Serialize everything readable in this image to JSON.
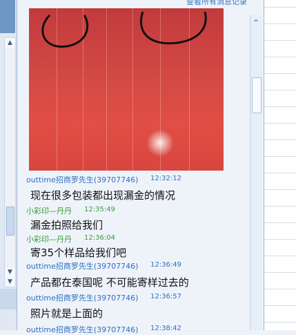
{
  "header": {
    "history_link": "查看所有消息记录"
  },
  "messages": [
    {
      "sender": "outtime招商罗先生(39707746)",
      "time": "12:32:12",
      "text": "现在很多包装都出现漏金的情况",
      "color": "#2f6fbd"
    },
    {
      "sender": "小彩印—丹丹",
      "time": "12:35:49",
      "text": "漏金拍照给我们",
      "color": "#3a9b3a"
    },
    {
      "sender": "小彩印—丹丹",
      "time": "12:36:04",
      "text": "寄35个样品给我们吧",
      "color": "#3a9b3a"
    },
    {
      "sender": "outtime招商罗先生(39707746)",
      "time": "12:36:49",
      "text": "产品都在泰国呢 不可能寄样过去的",
      "color": "#2f6fbd"
    },
    {
      "sender": "outtime招商罗先生(39707746)",
      "time": "12:36:57",
      "text": "照片就是上面的",
      "color": "#2f6fbd"
    },
    {
      "sender": "outtime招商罗先生(39707746)",
      "time": "12:38:42",
      "text": "",
      "color": "#2f6fbd"
    }
  ],
  "icons": {
    "scroll_up": "chevron-up-icon",
    "scroll_down": "chevron-down-icon",
    "chat_scroll_up": "chevron-up-icon"
  }
}
